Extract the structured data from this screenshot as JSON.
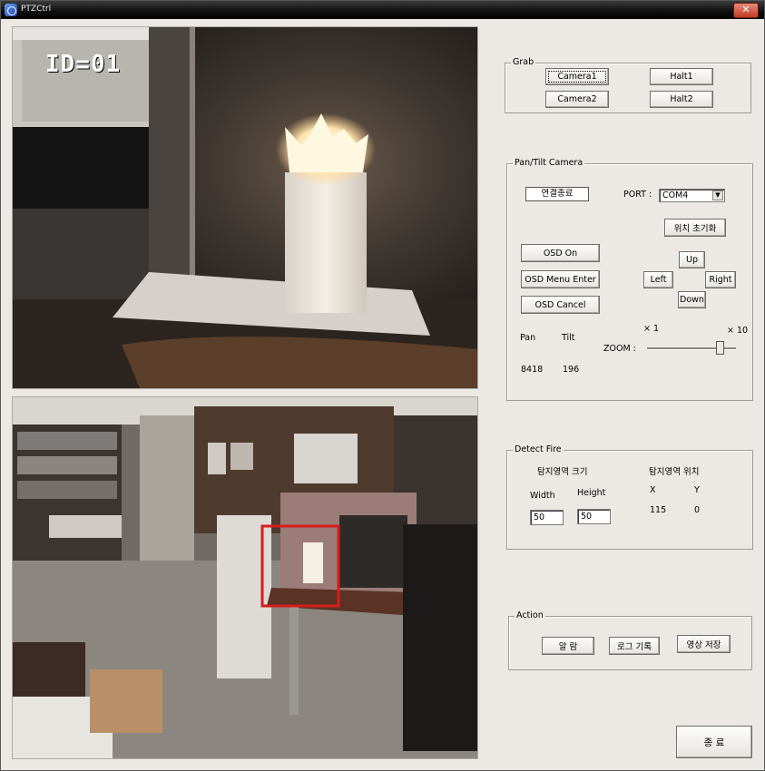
{
  "window": {
    "title": "PTZCtrl",
    "close_label": "✕"
  },
  "video": {
    "top_osd": "ID=01"
  },
  "grab": {
    "title": "Grab",
    "camera1": "Camera1",
    "camera2": "Camera2",
    "halt1": "Halt1",
    "halt2": "Halt2"
  },
  "pantilt": {
    "title": "Pan/Tilt Camera",
    "status": "연결종료",
    "port_label": "PORT :",
    "port_value": "COM4",
    "reset_position": "위치 초기화",
    "osd_on": "OSD On",
    "osd_menu_enter": "OSD Menu Enter",
    "osd_cancel": "OSD Cancel",
    "up": "Up",
    "left": "Left",
    "right": "Right",
    "down": "Down",
    "pan_label": "Pan",
    "tilt_label": "Tilt",
    "pan_value": "8418",
    "tilt_value": "196",
    "zoom_label": "ZOOM :",
    "zoom_min": "× 1",
    "zoom_max": "× 10",
    "zoom_level": 0.85
  },
  "detect": {
    "title": "Detect Fire",
    "size_heading": "탐지영역 크기",
    "pos_heading": "탐지영역 위치",
    "width_label": "Width",
    "height_label": "Height",
    "width_value": "50",
    "height_value": "50",
    "x_label": "X",
    "y_label": "Y",
    "x_value": "115",
    "y_value": "0"
  },
  "action": {
    "title": "Action",
    "alarm": "알 람",
    "log": "로그 기록",
    "save_video": "영상 저장"
  },
  "exit_label": "종 료"
}
